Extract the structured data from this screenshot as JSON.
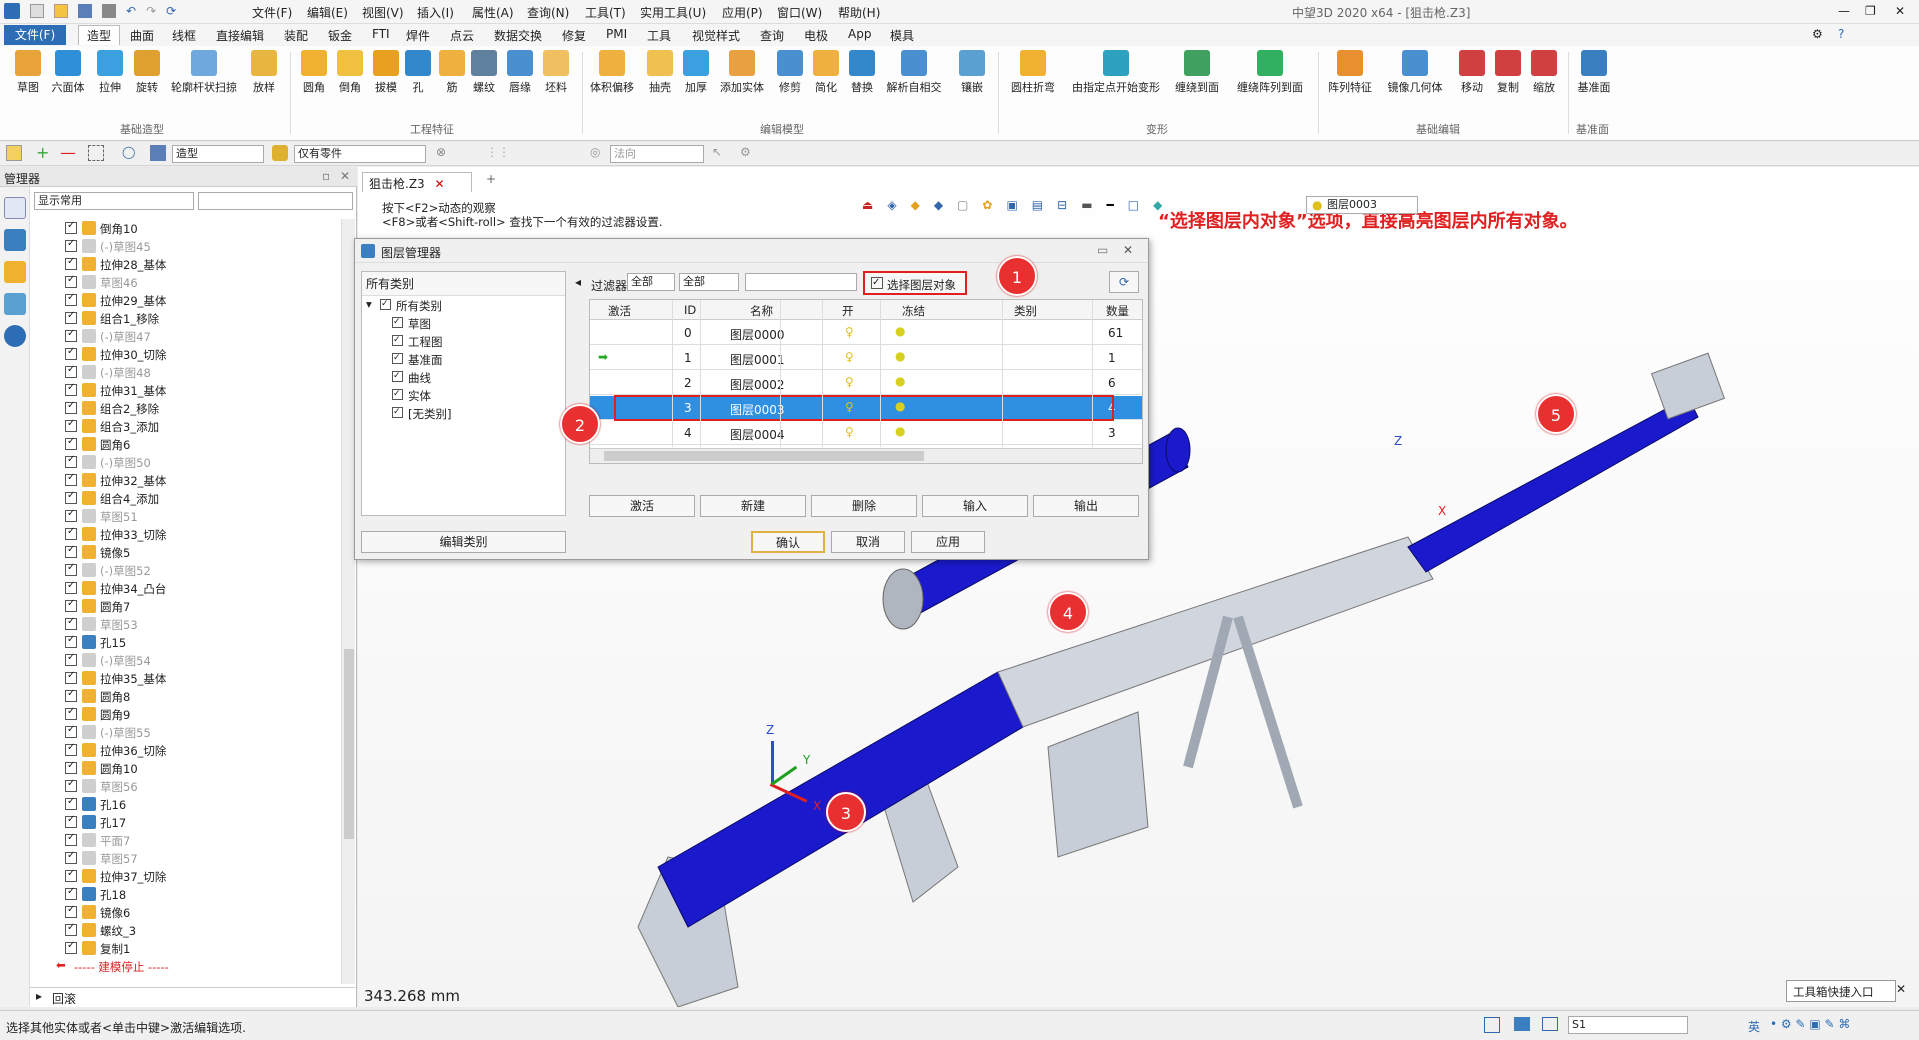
{
  "app": {
    "title": "中望3D 2020 x64 - [狙击枪.Z3]"
  },
  "menu": [
    "文件(F)",
    "编辑(E)",
    "视图(V)",
    "插入(I)",
    "属性(A)",
    "查询(N)",
    "工具(T)",
    "实用工具(U)",
    "应用(P)",
    "窗口(W)",
    "帮助(H)"
  ],
  "ribbon_tabs": [
    "文件(F)",
    "造型",
    "曲面",
    "线框",
    "直接编辑",
    "装配",
    "钣金",
    "FTI",
    "焊件",
    "点云",
    "数据交换",
    "修复",
    "PMI",
    "工具",
    "视觉样式",
    "查询",
    "电极",
    "App",
    "模具"
  ],
  "ribbon_groups": {
    "basic": {
      "label": "基础造型",
      "items": [
        "草图",
        "六面体",
        "拉伸",
        "旋转",
        "轮廓杆状扫掠",
        "放样"
      ]
    },
    "feature": {
      "label": "工程特征",
      "items": [
        "圆角",
        "倒角",
        "拔模",
        "孔",
        "筋",
        "螺纹",
        "唇缘",
        "坯料"
      ]
    },
    "edit": {
      "label": "编辑模型",
      "items": [
        "体积偏移",
        "抽壳",
        "加厚",
        "添加实体",
        "修剪",
        "简化",
        "替换",
        "解析自相交",
        "镶嵌"
      ]
    },
    "deform": {
      "label": "变形",
      "items": [
        "圆柱折弯",
        "由指定点开始变形",
        "缠绕到面",
        "缠绕阵列到面"
      ]
    },
    "baseedit": {
      "label": "基础编辑",
      "items": [
        "阵列特征",
        "镜像几何体",
        "移动",
        "复制",
        "缩放"
      ]
    },
    "datum": {
      "label": "基准面",
      "items": [
        "基准面"
      ]
    }
  },
  "toolbar2": {
    "mode": "造型",
    "filter": "仅有零件",
    "direction": "法向"
  },
  "manager": {
    "title": "管理器",
    "filter": "显示常用",
    "rollback": "回滚"
  },
  "tree": [
    "倒角10",
    "(-)草图45",
    "拉伸28_基体",
    "草图46",
    "拉伸29_基体",
    "组合1_移除",
    "(-)草图47",
    "拉伸30_切除",
    "(-)草图48",
    "拉伸31_基体",
    "组合2_移除",
    "组合3_添加",
    "圆角6",
    "(-)草图50",
    "拉伸32_基体",
    "组合4_添加",
    "草图51",
    "拉伸33_切除",
    "镜像5",
    "(-)草图52",
    "拉伸34_凸台",
    "圆角7",
    "草图53",
    "孔15",
    "(-)草图54",
    "拉伸35_基体",
    "圆角8",
    "圆角9",
    "(-)草图55",
    "拉伸36_切除",
    "圆角10",
    "草图56",
    "孔16",
    "孔17",
    "平面7",
    "草图57",
    "拉伸37_切除",
    "孔18",
    "镜像6",
    "螺纹_3",
    "复制1"
  ],
  "tree_stop": "----- 建模停止 -----",
  "doc": {
    "tab": "狙击枪.Z3",
    "hint1": "按下<F2>动态的观察",
    "hint2": "<F8>或者<Shift-roll> 查找下一个有效的过滤器设置.",
    "layer_combo": "图层0003"
  },
  "annotation": "“选择图层内对象”选项，直接高亮图层内所有对象。",
  "dialog": {
    "title": "图层管理器",
    "cat_header": "所有类别",
    "categories": [
      "所有类别",
      "草图",
      "工程图",
      "基准面",
      "曲线",
      "实体",
      "[无类别]"
    ],
    "filter_label": "过滤器",
    "filter1": "全部",
    "filter2": "全部",
    "select_layer_objects": "选择图层对象",
    "columns": [
      "激活",
      "ID",
      "名称",
      "开",
      "冻结",
      "类别",
      "数量"
    ],
    "rows": [
      {
        "id": "0",
        "name": "图层0000",
        "count": "61"
      },
      {
        "id": "1",
        "name": "图层0001",
        "count": "1"
      },
      {
        "id": "2",
        "name": "图层0002",
        "count": "6"
      },
      {
        "id": "3",
        "name": "图层0003",
        "count": "4"
      },
      {
        "id": "4",
        "name": "图层0004",
        "count": "3"
      }
    ],
    "actions": [
      "激活",
      "新建",
      "删除",
      "输入",
      "输出"
    ],
    "edit_category": "编辑类别",
    "ok": "确认",
    "cancel": "取消",
    "apply": "应用"
  },
  "markers": [
    "1",
    "2",
    "3",
    "4",
    "5"
  ],
  "viewport": {
    "distance": "343.268 mm",
    "axes": [
      "Z",
      "Y",
      "X"
    ]
  },
  "status": {
    "text": "选择其他实体或者<单击中键>激活编辑选项.",
    "s1": "S1",
    "quick": "工具箱快捷入口",
    "ime": "英"
  }
}
